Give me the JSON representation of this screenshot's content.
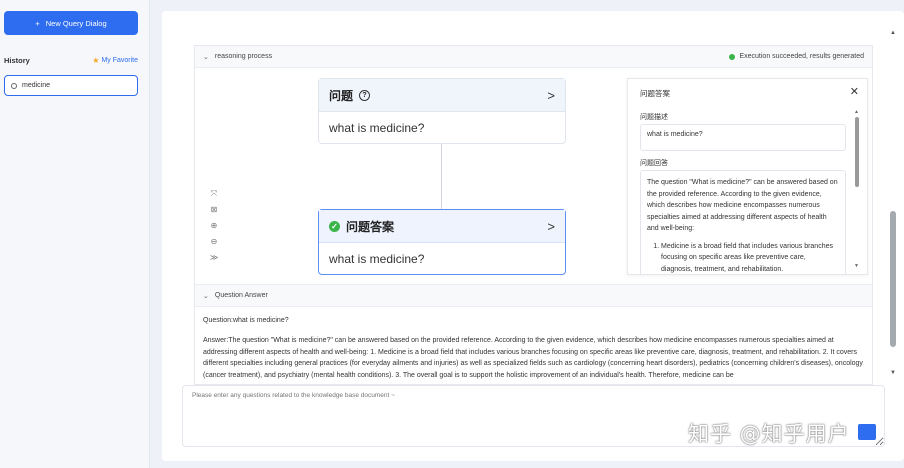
{
  "sidebar": {
    "new_dialog_label": "New Query Dialog",
    "new_dialog_icon": "plus-icon",
    "history_title": "History",
    "favorite_label": "My Favorite",
    "favorite_icon": "star-icon",
    "history_items": [
      {
        "label": "medicine"
      }
    ]
  },
  "reasoning": {
    "header_label": "reasoning process",
    "status_text": "Execution succeeded, results generated",
    "status_color": "#3bb54a",
    "nodes": [
      {
        "title": "问题",
        "icon": "question-circle-icon",
        "body": "what is medicine?"
      },
      {
        "title": "问题答案",
        "icon": "check-circle-icon",
        "body": "what is medicine?"
      }
    ],
    "zoom_controls": [
      "fit-screen-icon",
      "reset-icon",
      "zoom-in-icon",
      "zoom-out-icon",
      "collapse-icon"
    ]
  },
  "answer_panel": {
    "title": "问题答案",
    "desc_label": "问题描述",
    "desc_value": "what is medicine?",
    "answer_label": "问题回答",
    "answer_intro": "The question \"What is medicine?\" can be answered based on the provided reference. According to the given evidence, which describes how medicine encompasses numerous specialties aimed at addressing different aspects of health and well-being:",
    "answer_points": [
      "Medicine is a broad field that includes various branches focusing on specific areas like preventive care, diagnosis, treatment, and rehabilitation."
    ]
  },
  "question_answer": {
    "header_label": "Question Answer",
    "question_line": "Question:what is medicine?",
    "answer_text": "Answer:The question \"What is medicine?\" can be answered based on the provided reference. According to the given evidence, which describes how medicine encompasses numerous specialties aimed at addressing different aspects of health and well-being: 1. Medicine is a broad field that includes various branches focusing on specific areas like preventive care, diagnosis, treatment, and rehabilitation. 2. It covers different specialties including general practices (for everyday ailments and injuries) as well as specialized fields such as cardiology (concerning heart disorders), pediatrics (concerning children's diseases), oncology (cancer treatment), and psychiatry (mental health conditions). 3. The overall goal is to support the holistic improvement of an individual's health. Therefore, medicine can be"
  },
  "input": {
    "placeholder": "Please enter any questions related to the knowledge base document ~"
  },
  "watermark": "知乎 @知乎用户",
  "accent_color": "#2f6df0"
}
